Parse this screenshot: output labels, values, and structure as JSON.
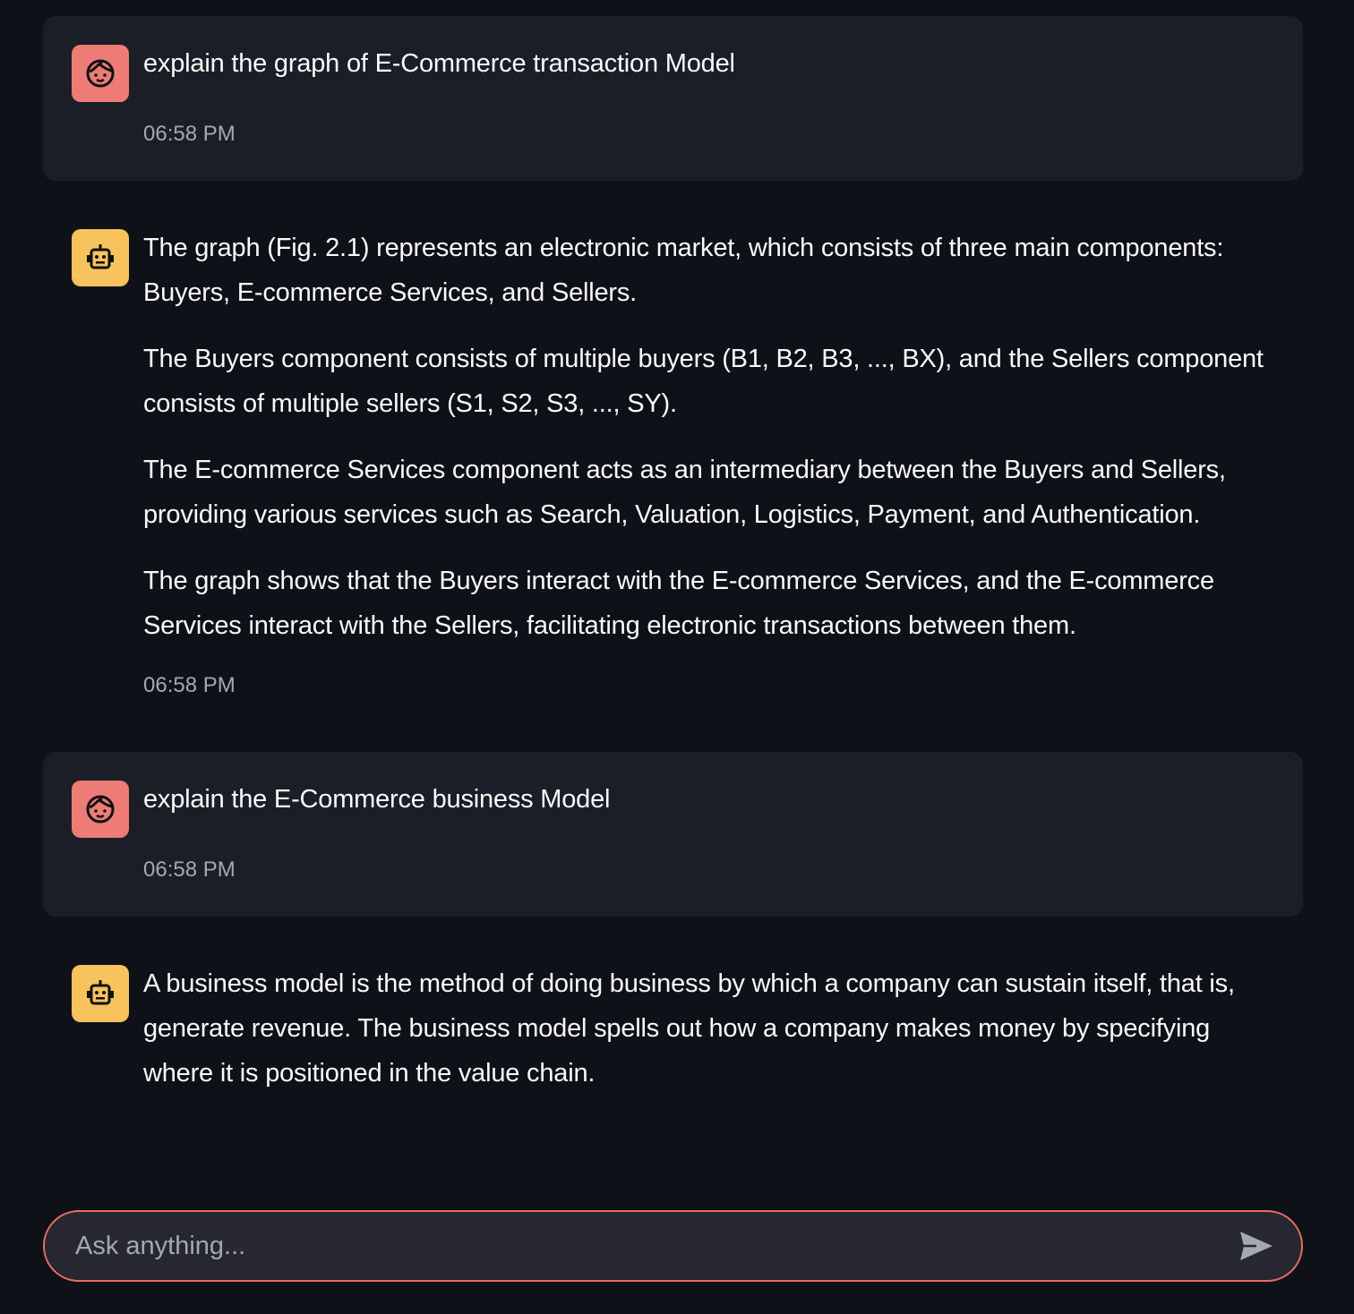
{
  "messages": [
    {
      "role": "user",
      "avatar_icon": "user-face-icon",
      "paragraphs": [
        "explain the graph of E-Commerce transaction Model"
      ],
      "time": "06:58 PM"
    },
    {
      "role": "assistant",
      "avatar_icon": "robot-icon",
      "paragraphs": [
        "The graph (Fig. 2.1) represents an electronic market, which consists of three main components: Buyers, E-commerce Services, and Sellers.",
        "The Buyers component consists of multiple buyers (B1, B2, B3, ..., BX), and the Sellers component consists of multiple sellers (S1, S2, S3, ..., SY).",
        "The E-commerce Services component acts as an intermediary between the Buyers and Sellers, providing various services such as Search, Valuation, Logistics, Payment, and Authentication.",
        "The graph shows that the Buyers interact with the E-commerce Services, and the E-commerce Services interact with the Sellers, facilitating electronic transactions between them."
      ],
      "time": "06:58 PM"
    },
    {
      "role": "user",
      "avatar_icon": "user-face-icon",
      "paragraphs": [
        "explain the E-Commerce business Model"
      ],
      "time": "06:58 PM"
    },
    {
      "role": "assistant",
      "avatar_icon": "robot-icon",
      "paragraphs": [
        "A business model is the method of doing business by which a company can sustain itself, that is, generate revenue. The business model spells out how a company makes money by specifying where it is positioned in the value chain."
      ]
    }
  ],
  "input": {
    "placeholder": "Ask anything...",
    "value": ""
  },
  "send_icon": "send-icon",
  "colors": {
    "background": "#0e1117",
    "user_bubble": "#1b1e26",
    "user_avatar": "#ed7b76",
    "assistant_avatar": "#f8c25c",
    "input_border": "#ed6a66"
  }
}
